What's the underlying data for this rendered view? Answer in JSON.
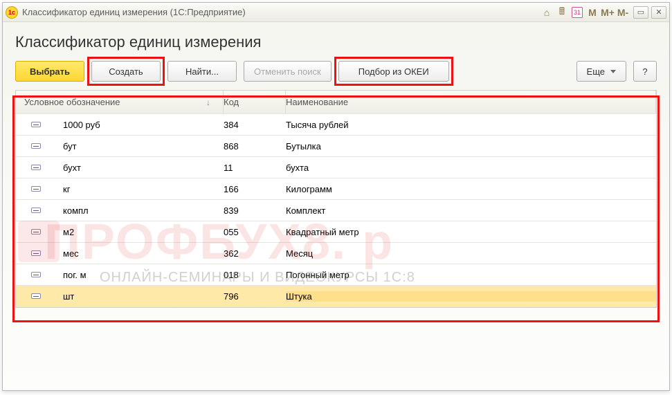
{
  "titlebar": {
    "title": "Классификатор единиц измерения  (1С:Предприятие)",
    "date_icon": "31",
    "m": "M",
    "mplus": "M+",
    "mminus": "M-"
  },
  "page": {
    "heading": "Классификатор единиц измерения"
  },
  "toolbar": {
    "select": "Выбрать",
    "create": "Создать",
    "find": "Найти...",
    "cancel_search": "Отменить поиск",
    "from_okei": "Подбор из ОКЕИ",
    "more": "Еще",
    "help": "?"
  },
  "table": {
    "headers": {
      "symbol": "Условное обозначение",
      "code": "Код",
      "name": "Наименование"
    },
    "rows": [
      {
        "symbol": "1000 руб",
        "code": "384",
        "name": "Тысяча рублей",
        "selected": false
      },
      {
        "symbol": "бут",
        "code": "868",
        "name": "Бутылка",
        "selected": false
      },
      {
        "symbol": "бухт",
        "code": "11",
        "name": "бухта",
        "selected": false
      },
      {
        "symbol": "кг",
        "code": "166",
        "name": "Килограмм",
        "selected": false
      },
      {
        "symbol": "компл",
        "code": "839",
        "name": "Комплект",
        "selected": false
      },
      {
        "symbol": "м2",
        "code": "055",
        "name": "Квадратный метр",
        "selected": false
      },
      {
        "symbol": "мес",
        "code": "362",
        "name": "Месяц",
        "selected": false
      },
      {
        "symbol": "пог. м",
        "code": "018",
        "name": "Погонный метр",
        "selected": false
      },
      {
        "symbol": "шт",
        "code": "796",
        "name": "Штука",
        "selected": true
      }
    ]
  },
  "watermark": {
    "big": "ПРОФБУХ8. р",
    "sub": "ОНЛАЙН-СЕМИНАРЫ И ВИДЕОКУРСЫ 1С:8"
  }
}
